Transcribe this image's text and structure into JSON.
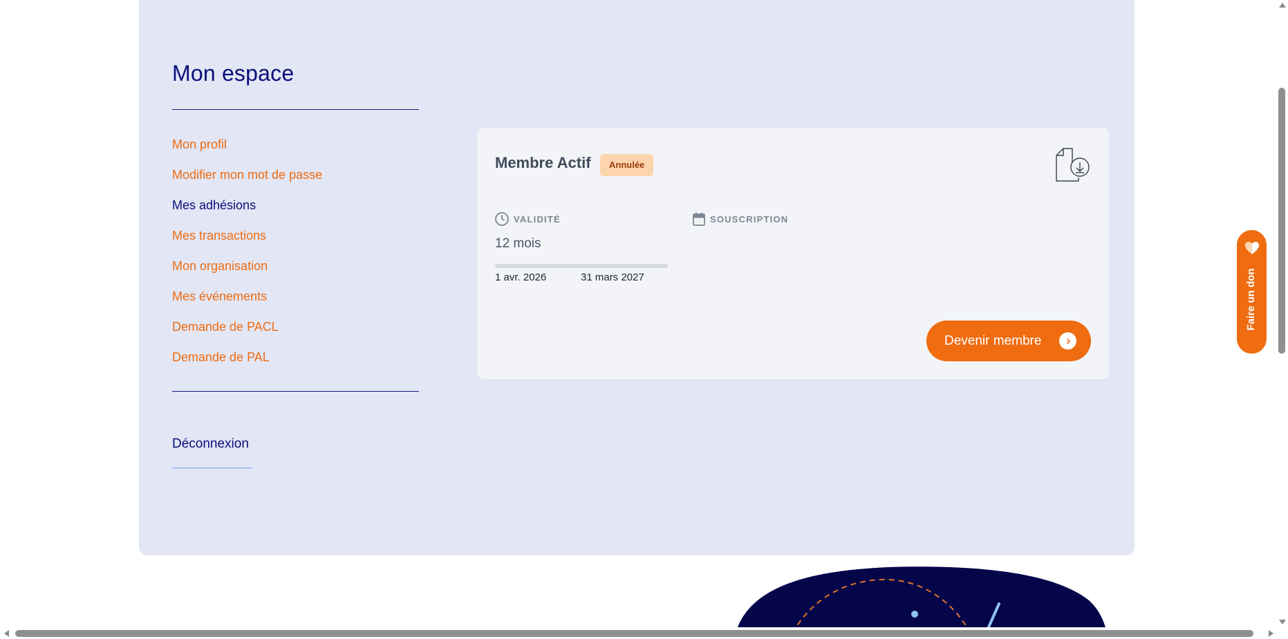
{
  "sidebar": {
    "title": "Mon espace",
    "items": [
      {
        "label": "Mon profil",
        "active": false
      },
      {
        "label": "Modifier mon mot de passe",
        "active": false
      },
      {
        "label": "Mes adhésions",
        "active": true
      },
      {
        "label": "Mes transactions",
        "active": false
      },
      {
        "label": "Mon organisation",
        "active": false
      },
      {
        "label": "Mes événements",
        "active": false
      },
      {
        "label": "Demande de PACL",
        "active": false
      },
      {
        "label": "Demande de PAL",
        "active": false
      }
    ],
    "logout_label": "Déconnexion"
  },
  "membership_card": {
    "title": "Membre Actif",
    "status_badge": "Annulée",
    "download_icon": "document-download-icon",
    "validity": {
      "label": "VALIDITÉ",
      "icon": "clock-icon",
      "value": "12 mois",
      "start_date": "1 avr. 2026",
      "end_date": "31 mars 2027",
      "progress": 0
    },
    "subscription": {
      "label": "SOUSCRIPTION",
      "icon": "calendar-icon"
    },
    "cta_label": "Devenir membre",
    "cta_icon": "chevron-right-icon"
  },
  "donate_tab": {
    "label": "Faire un don",
    "icon": "heart-icon"
  },
  "colors": {
    "panel_bg": "#e2e6f5",
    "card_bg": "#f3f4f7",
    "accent_orange": "#ef6c11",
    "navy": "#0a0f7a",
    "badge_bg": "#fdd5ad",
    "badge_text": "#9a3b0d"
  }
}
